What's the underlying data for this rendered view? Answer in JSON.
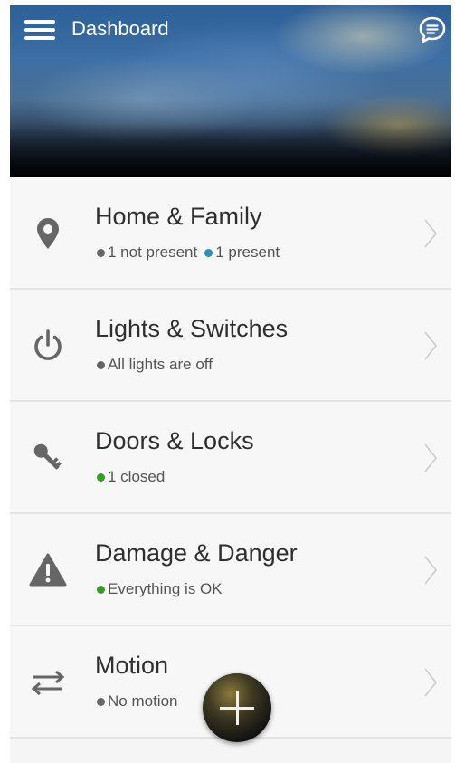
{
  "header": {
    "title": "Dashboard",
    "menu_icon": "hamburger-menu-icon",
    "chat_icon": "chat-bubble-icon"
  },
  "colors": {
    "dot_gray": "#666666",
    "dot_blue": "#2a8fbd",
    "dot_green": "#3a9d23",
    "icon_gray": "#666666",
    "chevron": "#cccccc"
  },
  "items": [
    {
      "title": "Home & Family",
      "icon": "location-pin-icon",
      "statuses": [
        {
          "text": "1 not present",
          "color": "gray"
        },
        {
          "text": "1 present",
          "color": "blue"
        }
      ]
    },
    {
      "title": "Lights & Switches",
      "icon": "power-icon",
      "statuses": [
        {
          "text": "All lights are off",
          "color": "gray"
        }
      ]
    },
    {
      "title": "Doors & Locks",
      "icon": "key-icon",
      "statuses": [
        {
          "text": "1 closed",
          "color": "green"
        }
      ]
    },
    {
      "title": "Damage & Danger",
      "icon": "warning-icon",
      "statuses": [
        {
          "text": "Everything is OK",
          "color": "green"
        }
      ]
    },
    {
      "title": "Motion",
      "icon": "arrows-exchange-icon",
      "statuses": [
        {
          "text": "No motion",
          "color": "gray"
        }
      ]
    }
  ],
  "fab": {
    "icon": "plus-icon"
  }
}
